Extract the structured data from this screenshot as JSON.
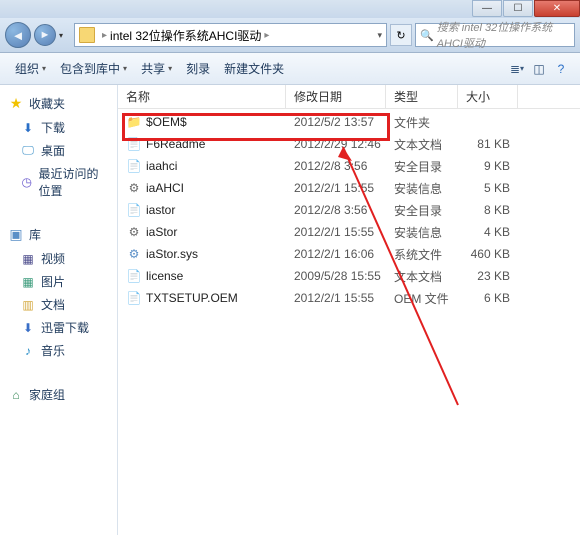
{
  "window": {
    "min": "—",
    "max": "☐",
    "close": "✕"
  },
  "address": {
    "back": "◄",
    "forward": "►",
    "drop": "▾",
    "path": "intel 32位操作系统AHCI驱动",
    "sep": "▸",
    "refresh": "↻"
  },
  "search": {
    "icon": "🔍",
    "placeholder": "搜索 intel 32位操作系统AHCI驱动"
  },
  "toolbar": {
    "organize": "组织",
    "include": "包含到库中",
    "share": "共享",
    "burn": "刻录",
    "newfolder": "新建文件夹",
    "drop": "▾"
  },
  "sidebar": {
    "favorites": "收藏夹",
    "downloads": "下载",
    "desktop": "桌面",
    "recent": "最近访问的位置",
    "library": "库",
    "video": "视频",
    "pictures": "图片",
    "documents": "文档",
    "thunder": "迅雷下载",
    "music": "音乐",
    "homegroup": "家庭组"
  },
  "columns": {
    "name": "名称",
    "date": "修改日期",
    "type": "类型",
    "size": "大小"
  },
  "rows": [
    {
      "icon": "folder",
      "name": "$OEM$",
      "date": "2012/5/2 13:57",
      "type": "文件夹",
      "size": ""
    },
    {
      "icon": "txt",
      "name": "F6Readme",
      "date": "2012/2/29 12:46",
      "type": "文本文档",
      "size": "81 KB"
    },
    {
      "icon": "sec",
      "name": "iaahci",
      "date": "2012/2/8 3:56",
      "type": "安全目录",
      "size": "9 KB"
    },
    {
      "icon": "inf",
      "name": "iaAHCI",
      "date": "2012/2/1 15:55",
      "type": "安装信息",
      "size": "5 KB"
    },
    {
      "icon": "sec",
      "name": "iastor",
      "date": "2012/2/8 3:56",
      "type": "安全目录",
      "size": "8 KB"
    },
    {
      "icon": "inf",
      "name": "iaStor",
      "date": "2012/2/1 15:55",
      "type": "安装信息",
      "size": "4 KB"
    },
    {
      "icon": "sys",
      "name": "iaStor.sys",
      "date": "2012/2/1 16:06",
      "type": "系统文件",
      "size": "460 KB"
    },
    {
      "icon": "txt",
      "name": "license",
      "date": "2009/5/28 15:55",
      "type": "文本文档",
      "size": "23 KB"
    },
    {
      "icon": "oem",
      "name": "TXTSETUP.OEM",
      "date": "2012/2/1 15:55",
      "type": "OEM 文件",
      "size": "6 KB"
    }
  ]
}
